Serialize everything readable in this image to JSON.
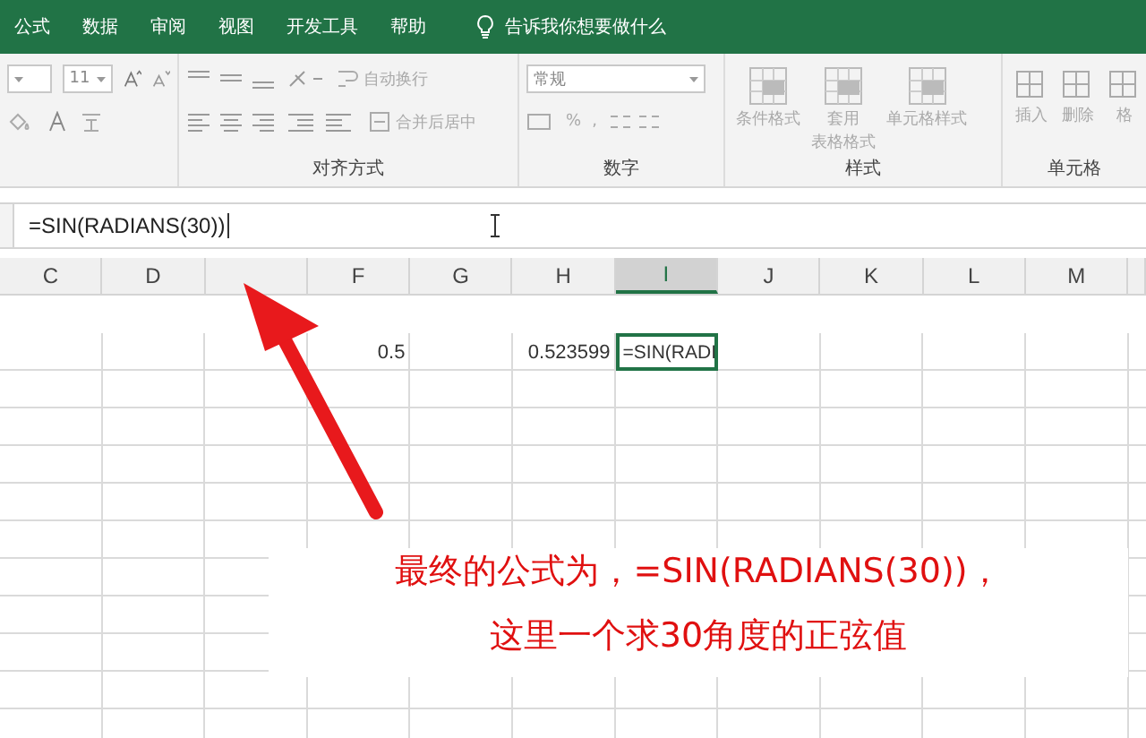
{
  "tabs": [
    {
      "label": "公式",
      "selected": false
    },
    {
      "label": "数据",
      "selected": false
    },
    {
      "label": "审阅",
      "selected": false
    },
    {
      "label": "视图",
      "selected": false
    },
    {
      "label": "开发工具",
      "selected": false
    },
    {
      "label": "帮助",
      "selected": false
    }
  ],
  "tell_me": "告诉我你想要做什么",
  "ribbon": {
    "font": {
      "size": "11"
    },
    "alignment": {
      "wrap": "自动换行",
      "merge": "合并后居中",
      "label": "对齐方式"
    },
    "number": {
      "format": "常规",
      "percent": "%",
      "comma": ",",
      "label": "数字"
    },
    "styles": {
      "buttons": [
        {
          "lines": [
            "条件格式"
          ]
        },
        {
          "lines": [
            "套用",
            "表格格式"
          ]
        },
        {
          "lines": [
            "单元格样式"
          ]
        }
      ],
      "label": "样式"
    },
    "cells": {
      "buttons": [
        "插入",
        "删除",
        "格"
      ],
      "label": "单元格"
    }
  },
  "formula_bar": {
    "value": "=SIN(RADIANS(30))"
  },
  "columns": [
    {
      "label": "C",
      "selected": false
    },
    {
      "label": "D",
      "selected": false
    },
    {
      "selected": false
    },
    {
      "label": "F",
      "selected": false
    },
    {
      "label": "G",
      "selected": false
    },
    {
      "label": "H",
      "selected": false
    },
    {
      "label": "I",
      "selected": true
    },
    {
      "label": "J",
      "selected": false
    },
    {
      "label": "K",
      "selected": false
    },
    {
      "label": "L",
      "selected": false
    },
    {
      "label": "M",
      "selected": false
    }
  ],
  "row": {
    "cells": [
      {
        "kind": "empty"
      },
      {
        "kind": "empty"
      },
      {
        "kind": "empty"
      },
      {
        "kind": "number",
        "value": "0.5",
        "selected": false
      },
      {
        "kind": "empty"
      },
      {
        "kind": "number",
        "value": "0.523599",
        "selected": false
      },
      {
        "kind": "formula",
        "value": "=SIN(RADI",
        "selected": true
      },
      {
        "kind": "empty"
      },
      {
        "kind": "empty"
      },
      {
        "kind": "empty"
      },
      {
        "kind": "empty"
      }
    ]
  },
  "annotation": [
    "最终的公式为，=SIN(RADIANS(30))，",
    "这里一个求30角度的正弦值"
  ]
}
